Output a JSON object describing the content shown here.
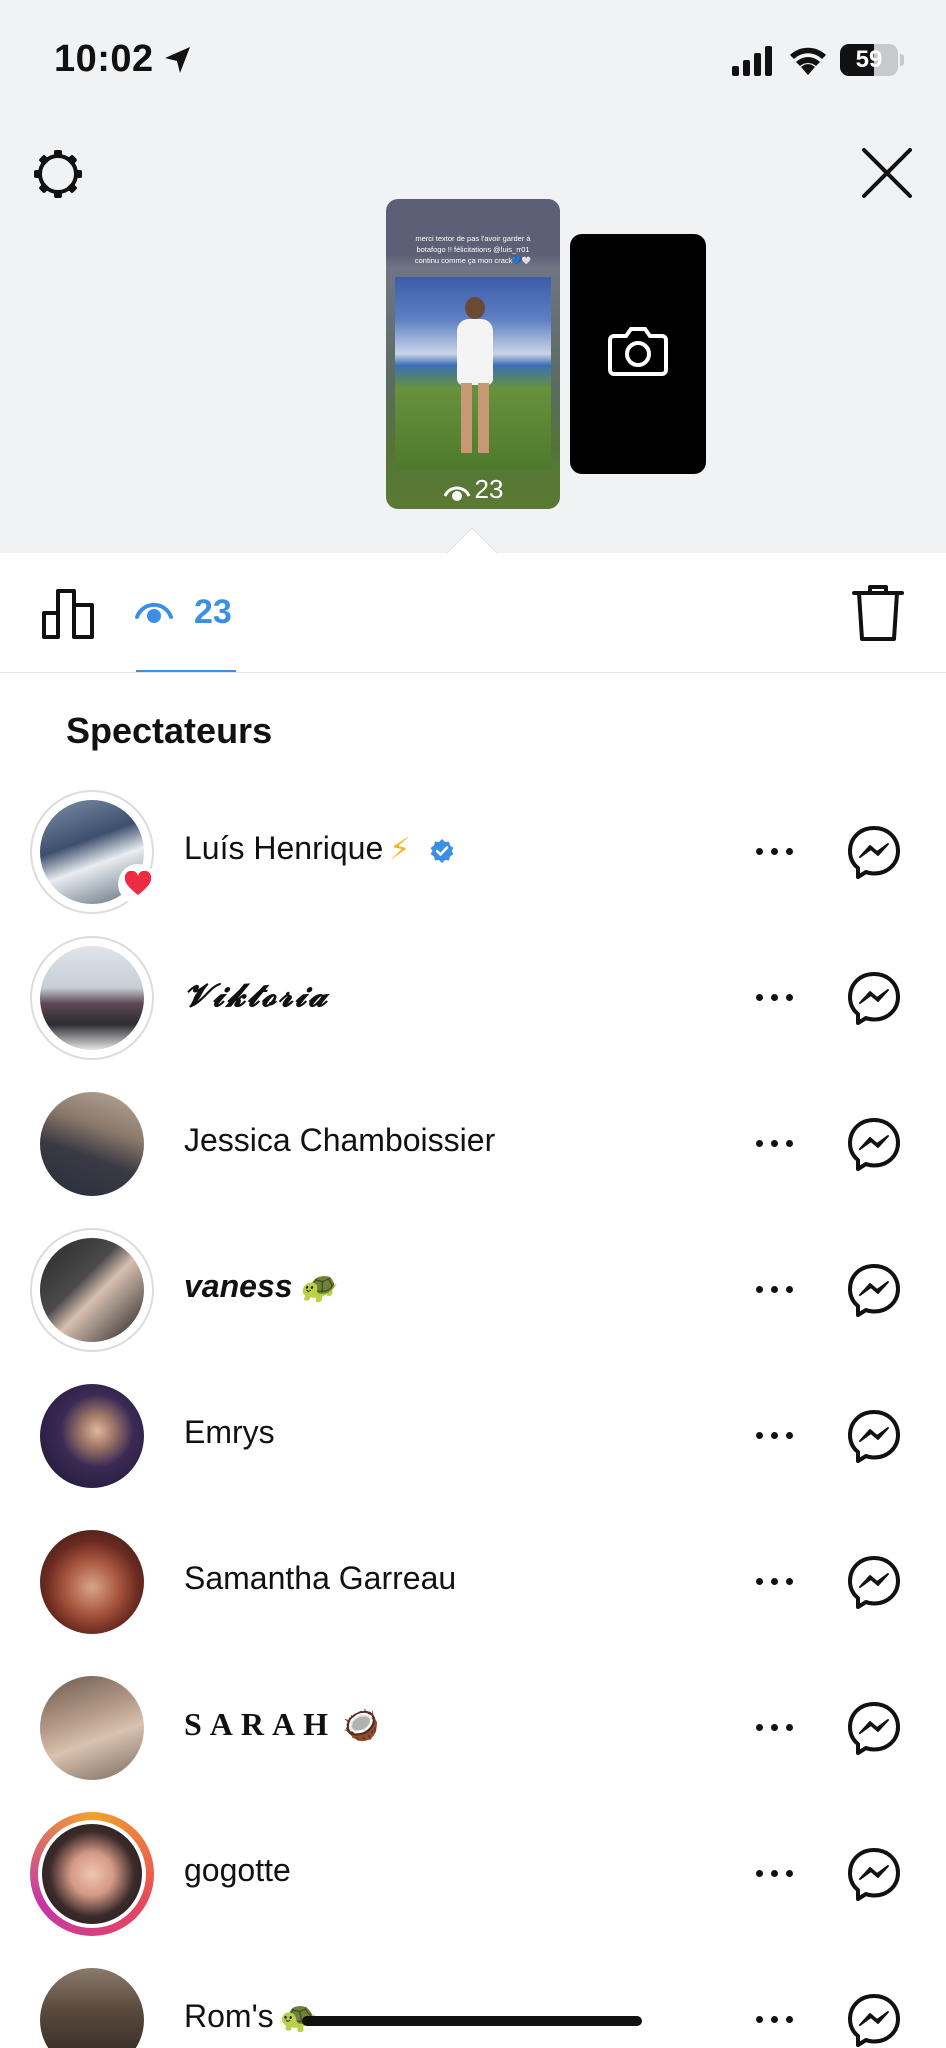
{
  "status_bar": {
    "time": "10:02",
    "battery": "59",
    "battery_level": 0.59
  },
  "story": {
    "caption": "merci textor de pas l'avoir garder à botafogo !! félicitations @luis_rr01 continu comme ça mon crack💙🤍",
    "views": "23"
  },
  "tabs": {
    "viewers_count": "23"
  },
  "section_title": "Spectateurs",
  "viewers": [
    {
      "name": "Luís Henrique",
      "emoji": "⚡",
      "verified": true,
      "liked": true,
      "ring": "grey"
    },
    {
      "name": "𝓥𝓲𝓴𝓽𝓸𝓻𝓲𝓪",
      "emoji": "",
      "verified": false,
      "liked": false,
      "ring": "grey"
    },
    {
      "name": "Jessica Chamboissier",
      "emoji": "",
      "verified": false,
      "liked": false,
      "ring": "none"
    },
    {
      "name": "vaness",
      "emoji": "🐢",
      "verified": false,
      "liked": false,
      "ring": "grey"
    },
    {
      "name": "Emrys",
      "emoji": "",
      "verified": false,
      "liked": false,
      "ring": "none"
    },
    {
      "name": "Samantha Garreau",
      "emoji": "",
      "verified": false,
      "liked": false,
      "ring": "none"
    },
    {
      "name": "SARAH",
      "emoji": "🥥",
      "verified": false,
      "liked": false,
      "ring": "none"
    },
    {
      "name": "gogotte",
      "emoji": "",
      "verified": false,
      "liked": false,
      "ring": "gradient"
    },
    {
      "name": "Rom's",
      "emoji": "🐢",
      "verified": false,
      "liked": false,
      "ring": "none"
    }
  ],
  "colors": {
    "accent": "#3c8fe8",
    "top_background": "#f1f2f4",
    "like": "#ed2b43"
  }
}
